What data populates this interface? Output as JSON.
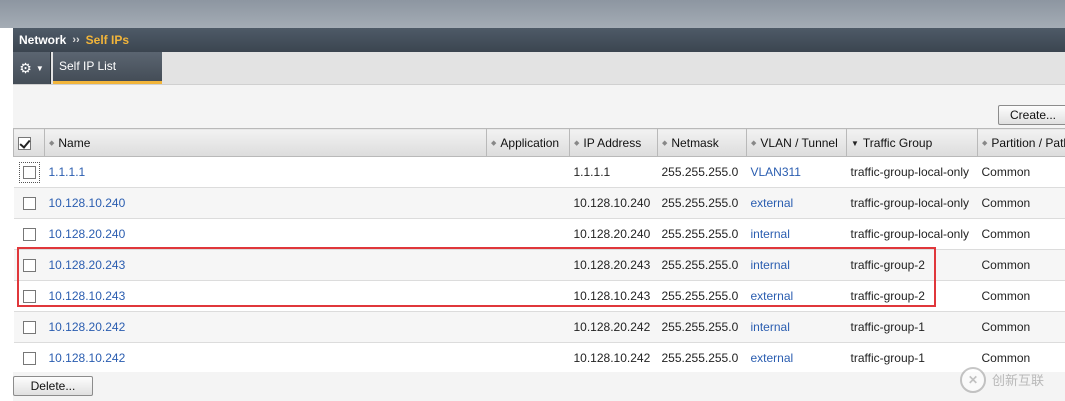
{
  "breadcrumb": {
    "parent": "Network",
    "separator": "››",
    "current": "Self IPs"
  },
  "tabs": {
    "selected_label": "Self IP List"
  },
  "toolbar": {
    "create_label": "Create...",
    "delete_label": "Delete..."
  },
  "table": {
    "columns": {
      "name": "Name",
      "application": "Application",
      "ip_address": "IP Address",
      "netmask": "Netmask",
      "vlan_tunnel": "VLAN / Tunnel",
      "traffic_group": "Traffic Group",
      "partition": "Partition / Path"
    },
    "rows": [
      {
        "name": "1.1.1.1",
        "application": "",
        "ip_address": "1.1.1.1",
        "netmask": "255.255.255.0",
        "vlan": "VLAN311",
        "traffic_group": "traffic-group-local-only",
        "partition": "Common"
      },
      {
        "name": "10.128.10.240",
        "application": "",
        "ip_address": "10.128.10.240",
        "netmask": "255.255.255.0",
        "vlan": "external",
        "traffic_group": "traffic-group-local-only",
        "partition": "Common"
      },
      {
        "name": "10.128.20.240",
        "application": "",
        "ip_address": "10.128.20.240",
        "netmask": "255.255.255.0",
        "vlan": "internal",
        "traffic_group": "traffic-group-local-only",
        "partition": "Common"
      },
      {
        "name": "10.128.20.243",
        "application": "",
        "ip_address": "10.128.20.243",
        "netmask": "255.255.255.0",
        "vlan": "internal",
        "traffic_group": "traffic-group-2",
        "partition": "Common"
      },
      {
        "name": "10.128.10.243",
        "application": "",
        "ip_address": "10.128.10.243",
        "netmask": "255.255.255.0",
        "vlan": "external",
        "traffic_group": "traffic-group-2",
        "partition": "Common"
      },
      {
        "name": "10.128.20.242",
        "application": "",
        "ip_address": "10.128.20.242",
        "netmask": "255.255.255.0",
        "vlan": "internal",
        "traffic_group": "traffic-group-1",
        "partition": "Common"
      },
      {
        "name": "10.128.10.242",
        "application": "",
        "ip_address": "10.128.10.242",
        "netmask": "255.255.255.0",
        "vlan": "external",
        "traffic_group": "traffic-group-1",
        "partition": "Common"
      }
    ]
  },
  "watermark": {
    "text": "创新互联"
  },
  "icons": {
    "settings": "gear-icon",
    "dropdown": "chevron-down-icon",
    "sort": "sort-icon"
  },
  "colors": {
    "accent": "#f2b53a",
    "link": "#2a5db0",
    "highlight": "#e0373b"
  }
}
